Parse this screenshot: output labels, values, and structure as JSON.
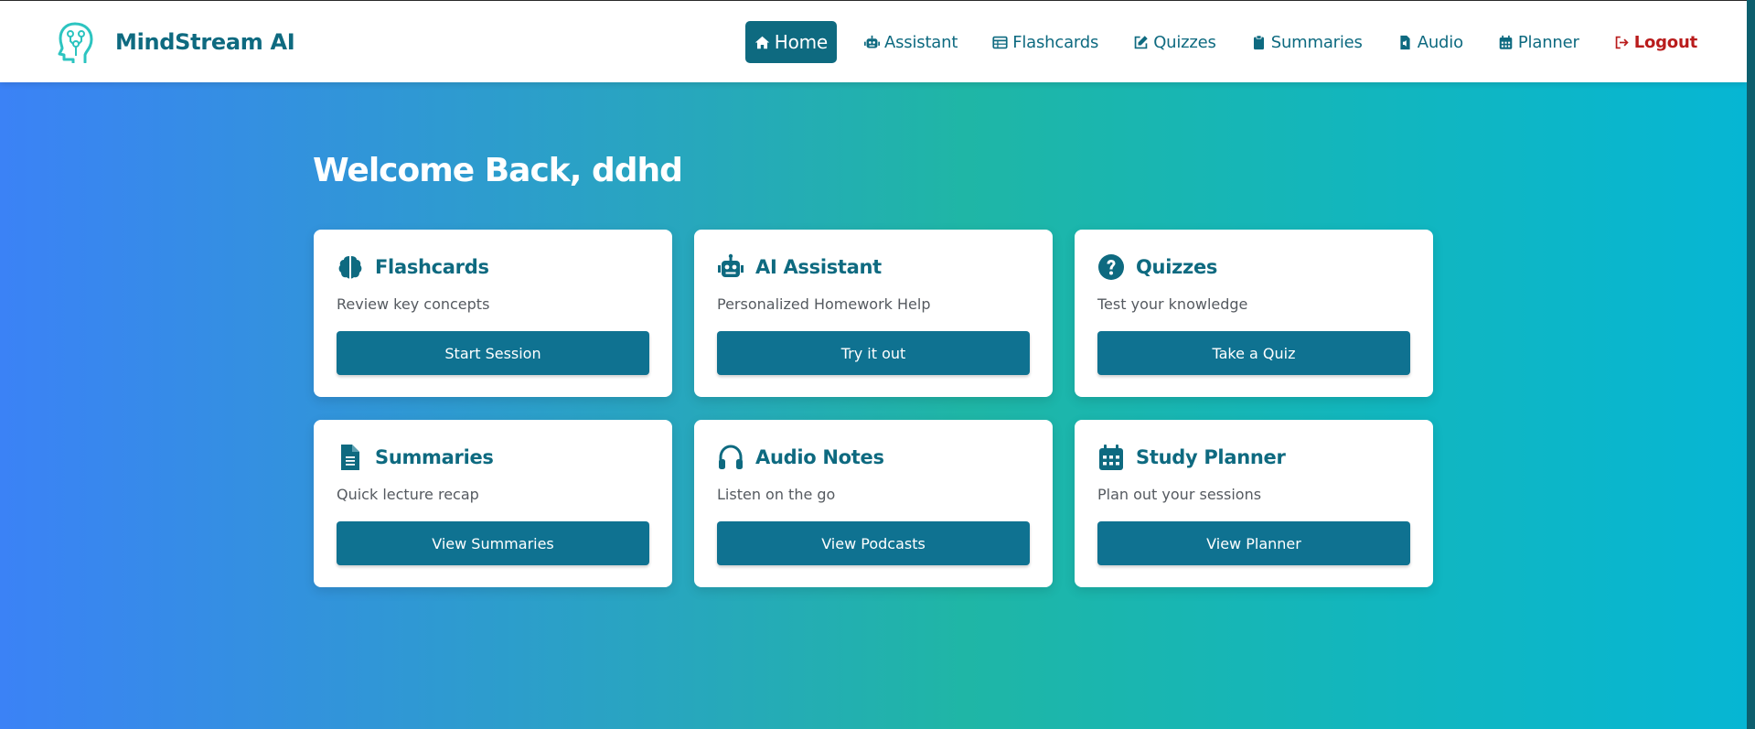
{
  "brand": {
    "name": "MindStream AI",
    "logo_icon": "head-circuit-icon"
  },
  "nav": {
    "items": [
      {
        "label": "Home",
        "icon": "home-icon",
        "active": true
      },
      {
        "label": "Assistant",
        "icon": "robot-icon"
      },
      {
        "label": "Flashcards",
        "icon": "table-icon"
      },
      {
        "label": "Quizzes",
        "icon": "edit-icon"
      },
      {
        "label": "Summaries",
        "icon": "clipboard-icon"
      },
      {
        "label": "Audio",
        "icon": "audio-file-icon"
      },
      {
        "label": "Planner",
        "icon": "calendar-icon"
      },
      {
        "label": "Logout",
        "icon": "logout-icon"
      }
    ]
  },
  "welcome": "Welcome Back, ddhd",
  "cards": [
    {
      "title": "Flashcards",
      "desc": "Review key concepts",
      "button": "Start Session",
      "icon": "brain-icon"
    },
    {
      "title": "AI Assistant",
      "desc": "Personalized Homework Help",
      "button": "Try it out",
      "icon": "robot-icon"
    },
    {
      "title": "Quizzes",
      "desc": "Test your knowledge",
      "button": "Take a Quiz",
      "icon": "question-circle-icon"
    },
    {
      "title": "Summaries",
      "desc": "Quick lecture recap",
      "button": "View Summaries",
      "icon": "document-icon"
    },
    {
      "title": "Audio Notes",
      "desc": "Listen on the go",
      "button": "View Podcasts",
      "icon": "headphones-icon"
    },
    {
      "title": "Study Planner",
      "desc": "Plan out your sessions",
      "button": "View Planner",
      "icon": "calendar-icon"
    }
  ],
  "colors": {
    "primary": "#0e6a80",
    "button": "#0f7291",
    "logout": "#b91c1c",
    "logo_accent": "#2cc4c0",
    "gradient_start": "#3b82f6",
    "gradient_mid": "#1fb6a6",
    "gradient_end": "#06b6d4"
  }
}
